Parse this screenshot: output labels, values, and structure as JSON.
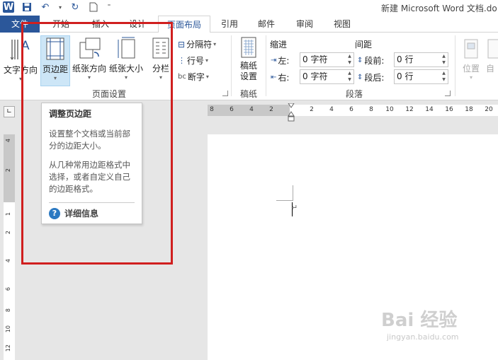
{
  "titlebar": {
    "title": "新建 Microsoft Word 文档.do"
  },
  "tabs": {
    "file": "文件",
    "start": "开始",
    "insert": "插入",
    "design": "设计",
    "layout": "页面布局",
    "references": "引用",
    "mailings": "邮件",
    "review": "审阅",
    "view": "视图"
  },
  "ribbon": {
    "text_direction": "文字方向",
    "margins": "页边距",
    "orientation": "纸张方向",
    "size": "纸张大小",
    "columns": "分栏",
    "breaks": "分隔符",
    "line_numbers": "行号",
    "hyphenation": "断字",
    "page_setup_group": "页面设置",
    "manuscript_line1": "稿纸",
    "manuscript_line2": "设置",
    "manuscript_group": "稿纸",
    "indent_header": "缩进",
    "spacing_header": "间距",
    "indent_left_label": "左:",
    "indent_right_label": "右:",
    "indent_left_value": "0 字符",
    "indent_right_value": "0 字符",
    "space_before_label": "段前:",
    "space_after_label": "段后:",
    "space_before_value": "0 行",
    "space_after_value": "0 行",
    "paragraph_group": "段落",
    "position": "位置",
    "wrap_partial": "自"
  },
  "ruler": {
    "h_numbers": [
      "8",
      "6",
      "4",
      "2",
      "2",
      "4",
      "6",
      "8",
      "10",
      "12",
      "14",
      "16",
      "18",
      "20"
    ],
    "v_numbers": [
      "4",
      "2",
      "1",
      "2",
      "4",
      "6",
      "8",
      "10",
      "12"
    ]
  },
  "tooltip": {
    "title": "调整页边距",
    "para1": "设置整个文档或当前部分的边距大小。",
    "para2": "从几种常用边距格式中选择，或者自定义自己的边距格式。",
    "help": "详细信息"
  },
  "watermark": {
    "brand": "Bai 经验",
    "url": "jingyan.baidu.com"
  },
  "colors": {
    "accent": "#2b579a",
    "highlight": "#d01f1f"
  }
}
